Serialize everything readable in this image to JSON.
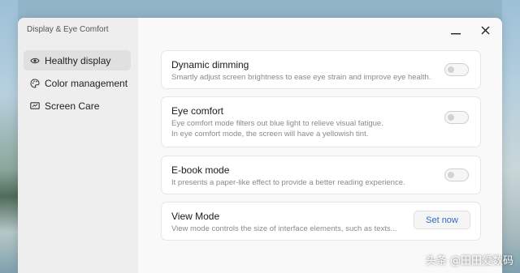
{
  "window": {
    "title": "Display & Eye Comfort"
  },
  "sidebar": {
    "items": [
      {
        "label": "Healthy display",
        "icon": "eye-icon",
        "active": true
      },
      {
        "label": "Color management",
        "icon": "palette-icon",
        "active": false
      },
      {
        "label": "Screen Care",
        "icon": "screen-icon",
        "active": false
      }
    ]
  },
  "settings": {
    "dynamic_dimming": {
      "title": "Dynamic dimming",
      "desc": "Smartly adjust screen brightness to ease eye strain and improve eye health.",
      "enabled": false
    },
    "eye_comfort": {
      "title": "Eye comfort",
      "desc1": "Eye comfort mode filters out blue light to relieve visual fatigue.",
      "desc2": "In eye comfort mode, the screen will have a yellowish tint.",
      "enabled": false
    },
    "ebook_mode": {
      "title": "E-book mode",
      "desc": "It presents a paper-like effect to provide a better reading experience.",
      "enabled": false
    },
    "view_mode": {
      "title": "View Mode",
      "desc": "View mode controls the size of interface elements, such as texts...",
      "button": "Set now"
    }
  },
  "watermark": "头条 @田田爱数码",
  "colors": {
    "accent": "#2a6cc4",
    "sidebar_active": "#e0e0e0"
  }
}
